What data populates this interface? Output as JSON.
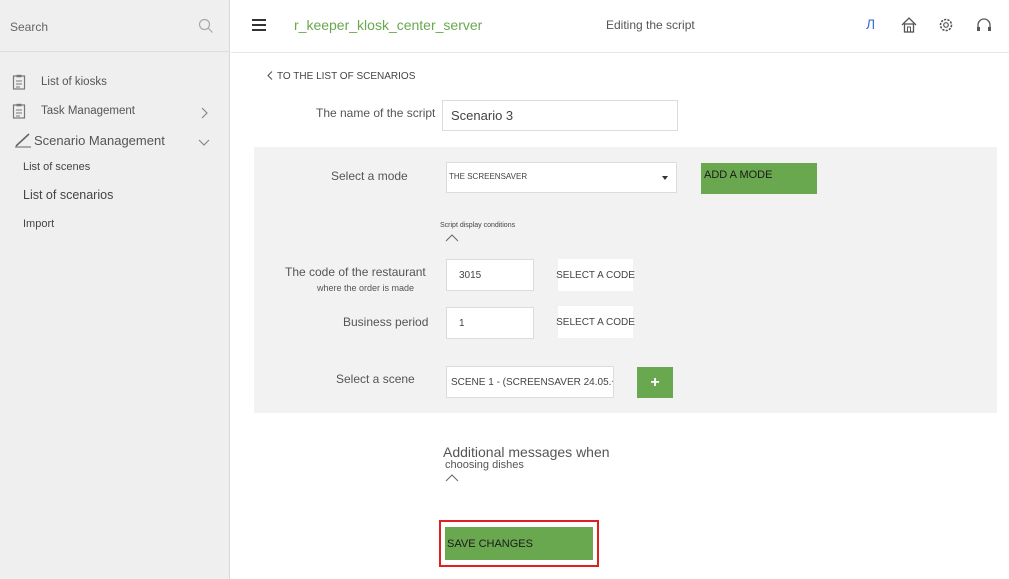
{
  "sidebar": {
    "search_placeholder": "Search",
    "items": [
      {
        "label": "List of kiosks",
        "icon": "clipboard-icon"
      },
      {
        "label": "Task Management",
        "icon": "clipboard-icon"
      },
      {
        "label": "Scenario Management",
        "icon": "pencil-icon"
      }
    ],
    "sub_items": [
      "List of scenes",
      "List of scenarios",
      "Import"
    ]
  },
  "header": {
    "app_title": "r_keeper_klosk_center_server",
    "page_caption": "Editing the script",
    "language_letter": "Л"
  },
  "form": {
    "back_link": "TO THE LIST OF SCENARIOS",
    "script_name_label": "The name of the script",
    "script_name_value": "Scenario 3",
    "mode_label": "Select a mode",
    "mode_value": "THE SCREENSAVER",
    "add_mode_button": "ADD A MODE",
    "conditions_label": "Script display conditions",
    "restaurant_label": "The code of the restaurant",
    "restaurant_sublabel": "where the order is made",
    "restaurant_value": "3015",
    "select_code_button": "SELECT A CODE",
    "business_period_label": "Business period",
    "business_period_value": "1",
    "select_code_button_2": "SELECT A CODE",
    "scene_label": "Select a scene",
    "scene_value": "SCENE 1 - (SCREENSAVER 24.05.+",
    "add_scene_button": "+",
    "additional_messages_title": "Additional messages when",
    "additional_messages_subtitle": "choosing dishes",
    "save_button": "SAVE CHANGES"
  },
  "colors": {
    "accent_green": "#6aa84f",
    "highlight_red": "#e02020",
    "language_blue": "#3b6fd6"
  }
}
